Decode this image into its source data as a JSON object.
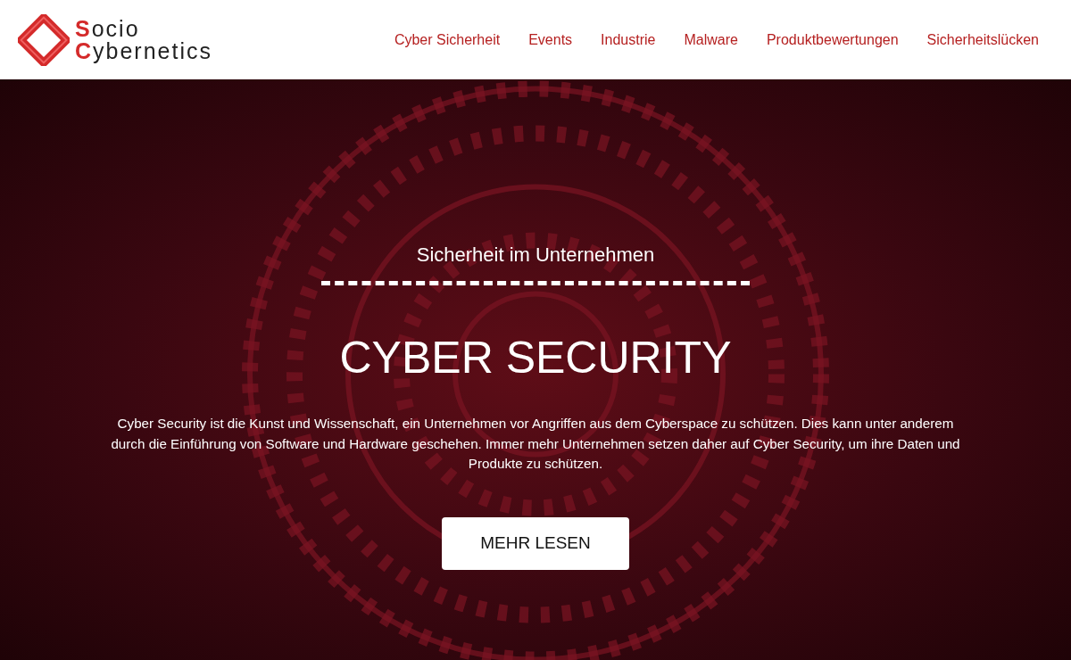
{
  "logo": {
    "line_1": "Socio",
    "line_2": "Cybernetics"
  },
  "nav": [
    {
      "label": "Cyber Sicherheit"
    },
    {
      "label": "Events"
    },
    {
      "label": "Industrie"
    },
    {
      "label": "Malware"
    },
    {
      "label": "Produktbewertungen"
    },
    {
      "label": "Sicherheitslücken"
    }
  ],
  "hero": {
    "subtitle": "Sicherheit im Unternehmen",
    "title": "CYBER SECURITY",
    "text": "Cyber Security ist die Kunst und Wissenschaft, ein Unternehmen vor Angriffen aus dem Cyberspace zu schützen. Dies kann unter anderem durch die Einführung von Software und Hardware geschehen. Immer mehr Unternehmen setzen daher auf Cyber Security, um ihre Daten und Produkte zu schützen.",
    "button": "MEHR LESEN"
  }
}
